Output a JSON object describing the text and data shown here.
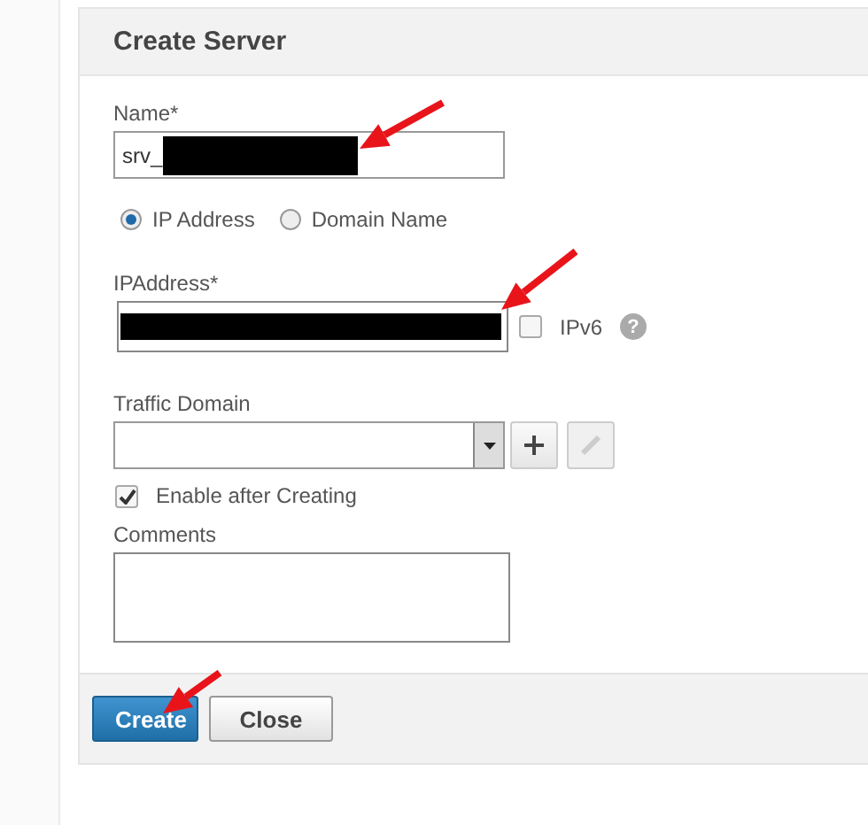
{
  "dialog_title": "Create Server",
  "name_field": {
    "label": "Name*",
    "value": "srv_"
  },
  "address_type": [
    {
      "label": "IP Address",
      "selected": true
    },
    {
      "label": "Domain Name",
      "selected": false
    }
  ],
  "ip_field": {
    "label": "IPAddress*"
  },
  "ipv6": {
    "label": "IPv6",
    "checked": false,
    "help": "?"
  },
  "traffic_domain": {
    "label": "Traffic Domain"
  },
  "enable_after_creating": {
    "label": "Enable after Creating",
    "checked": true
  },
  "comments": {
    "label": "Comments"
  },
  "buttons": [
    {
      "label": "Create",
      "kind": "primary"
    },
    {
      "label": "Close",
      "kind": "secondary"
    }
  ]
}
